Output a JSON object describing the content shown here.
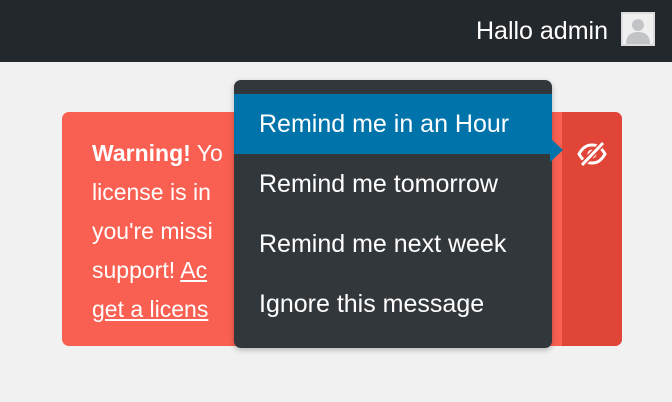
{
  "adminbar": {
    "greeting": "Hallo admin",
    "avatar_icon": "user-avatar-icon",
    "background": "#23282d"
  },
  "notice": {
    "background": "#fa6051",
    "strip_background": "#e04538",
    "lines": [
      {
        "bold": "Warning!",
        "text": " Yo"
      },
      {
        "text": "license is in"
      },
      {
        "text": "you're missi"
      },
      {
        "text": "support! ",
        "link": "Ac"
      },
      {
        "link": "get a licens"
      }
    ],
    "dismiss_icon": "eye-slash-icon"
  },
  "menu": {
    "background": "#32373c",
    "active_color": "#0073aa",
    "items": [
      {
        "label": "Remind me in an Hour",
        "active": true
      },
      {
        "label": "Remind me tomorrow",
        "active": false
      },
      {
        "label": "Remind me next week",
        "active": false
      },
      {
        "label": "Ignore this message",
        "active": false
      }
    ]
  }
}
